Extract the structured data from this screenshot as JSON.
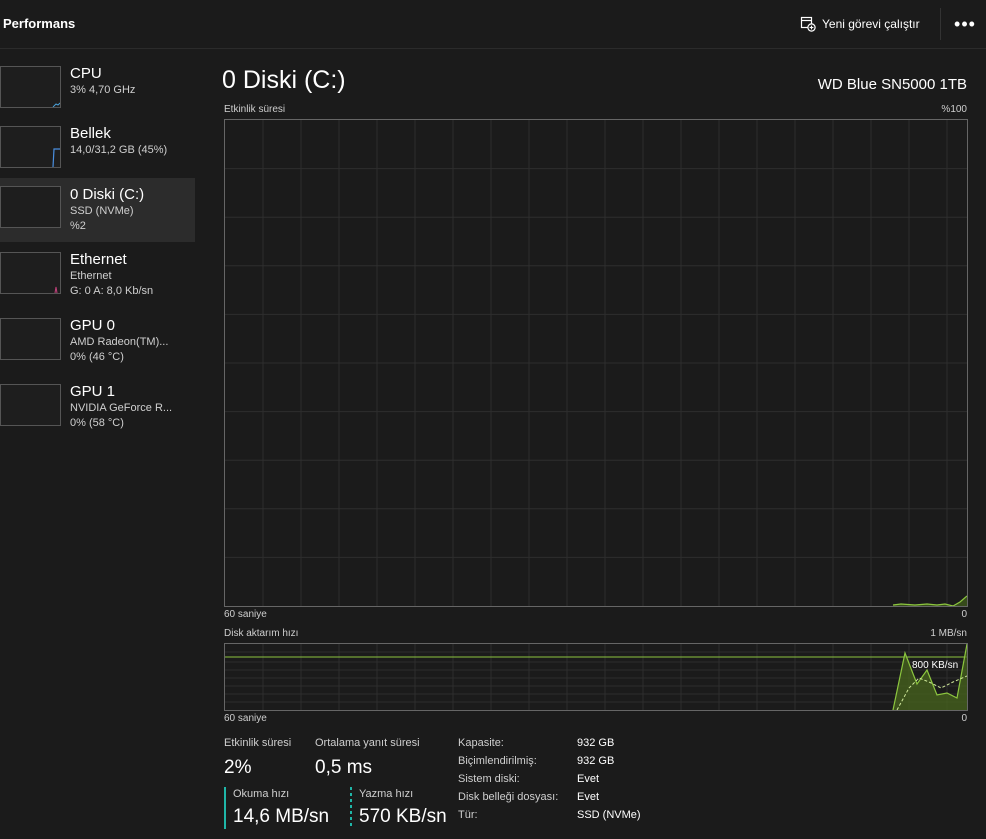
{
  "header": {
    "title": "Performans",
    "run_task_label": "Yeni görevi çalıştır",
    "more_label": "•••"
  },
  "sidebar": {
    "items": [
      {
        "name": "CPU",
        "line1": "3%  4,70 GHz",
        "line2": ""
      },
      {
        "name": "Bellek",
        "line1": "14,0/31,2 GB (45%)",
        "line2": ""
      },
      {
        "name": "0 Diski (C:)",
        "line1": "SSD (NVMe)",
        "line2": "%2"
      },
      {
        "name": "Ethernet",
        "line1": "Ethernet",
        "line2": "G: 0  A: 8,0 Kb/sn"
      },
      {
        "name": "GPU 0",
        "line1": "AMD Radeon(TM)...",
        "line2": "0%  (46 °C)"
      },
      {
        "name": "GPU 1",
        "line1": "NVIDIA GeForce R...",
        "line2": "0%  (58 °C)"
      }
    ]
  },
  "main": {
    "title": "0 Diski (C:)",
    "model": "WD Blue SN5000 1TB"
  },
  "activity_graph": {
    "label": "Etkinlik süresi",
    "max_label": "%100",
    "x_left_label": "60 saniye",
    "x_right_label": "0"
  },
  "transfer_graph": {
    "label": "Disk aktarım hızı",
    "max_label": "1 MB/sn",
    "marker_label": "800 KB/sn",
    "x_left_label": "60 saniye",
    "x_right_label": "0"
  },
  "stats": {
    "activity_label": "Etkinlik süresi",
    "activity_value": "2%",
    "response_label": "Ortalama yanıt süresi",
    "response_value": "0,5 ms",
    "read_label": "Okuma hızı",
    "read_value": "14,6 MB/sn",
    "write_label": "Yazma hızı",
    "write_value": "570 KB/sn"
  },
  "properties": {
    "capacity_label": "Kapasite:",
    "capacity_value": "932 GB",
    "formatted_label": "Biçimlendirilmiş:",
    "formatted_value": "932 GB",
    "system_label": "Sistem diski:",
    "system_value": "Evet",
    "pagefile_label": "Disk belleği dosyası:",
    "pagefile_value": "Evet",
    "type_label": "Tür:",
    "type_value": "SSD (NVMe)"
  },
  "colors": {
    "accent_disk": "#8cc63f",
    "accent_stat": "#1fb6a8",
    "memory_line": "#4a8fe0",
    "ethernet_line": "#c0407a"
  }
}
